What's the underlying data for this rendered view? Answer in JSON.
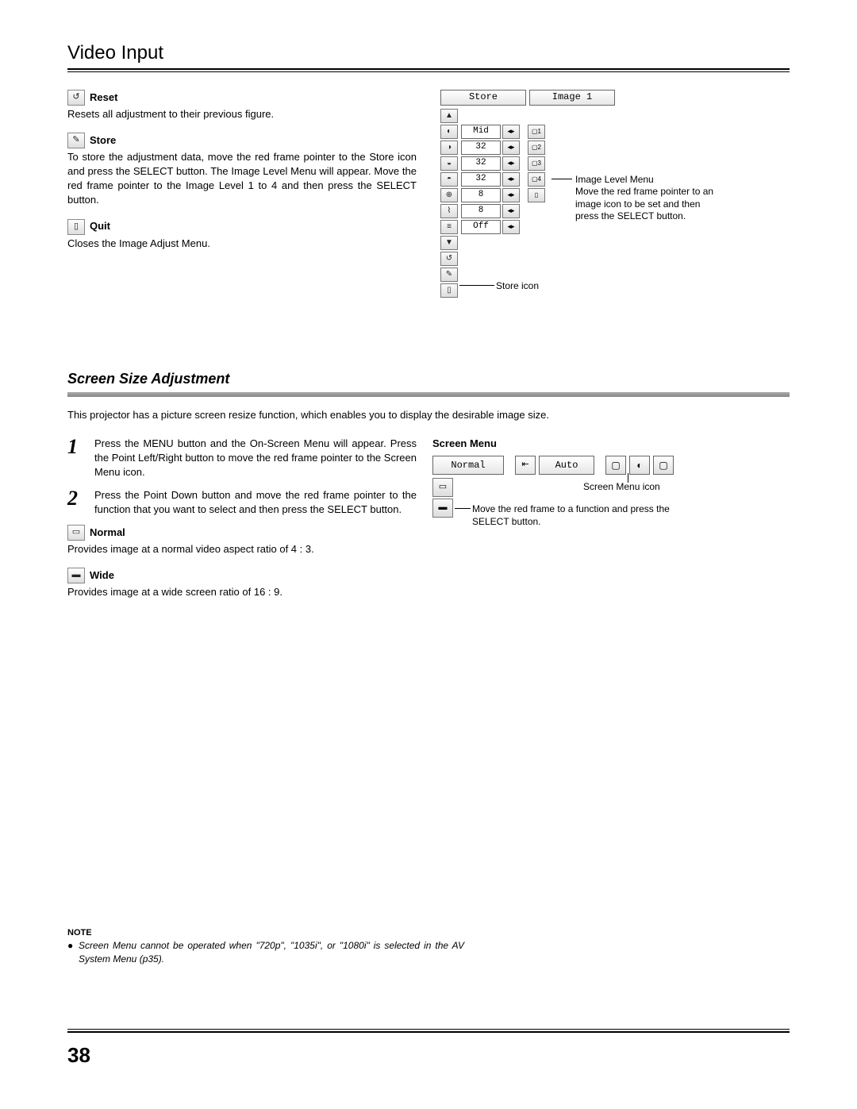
{
  "page": {
    "title": "Video Input",
    "number": "38"
  },
  "items": {
    "reset": {
      "label": "Reset",
      "desc": "Resets all adjustment to their previous figure."
    },
    "store": {
      "label": "Store",
      "desc": "To store the adjustment data, move the red frame pointer to the Store icon and press the SELECT button.  The Image Level Menu will appear.  Move the red frame pointer to the Image Level 1 to 4 and then press the SELECT button."
    },
    "quit": {
      "label": "Quit",
      "desc": "Closes the Image Adjust Menu."
    },
    "normal": {
      "label": "Normal",
      "desc": "Provides image at a normal video aspect ratio of 4 : 3."
    },
    "wide": {
      "label": "Wide",
      "desc": "Provides image at a wide screen ratio of 16 : 9."
    }
  },
  "osd": {
    "top_store": "Store",
    "top_image": "Image 1",
    "rows": [
      {
        "value": "Mid",
        "numLabel": "1"
      },
      {
        "value": "32",
        "numLabel": "2"
      },
      {
        "value": "32",
        "numLabel": "3"
      },
      {
        "value": "32",
        "numLabel": "4"
      },
      {
        "value": "8",
        "numLabel": ""
      },
      {
        "value": "8",
        "numLabel": ""
      },
      {
        "value": "Off",
        "numLabel": ""
      }
    ],
    "annot_title": "Image Level Menu",
    "annot_body": "Move the red frame pointer to an image icon to be set and then press the SELECT button.",
    "store_icon_label": "Store icon"
  },
  "section2": {
    "title": "Screen Size Adjustment",
    "intro": "This projector has a picture screen resize function, which enables you to display the desirable image size.",
    "step1": "Press the MENU button and the On-Screen Menu will appear. Press the Point Left/Right button to move the red frame pointer to the Screen Menu icon.",
    "step2": "Press the Point Down button and move the red frame pointer to the function that you want to select and then press the SELECT button.",
    "num1": "1",
    "num2": "2",
    "screen_menu_title": "Screen Menu",
    "normal_btn": "Normal",
    "auto_btn": "Auto",
    "annot_icon": "Screen Menu icon",
    "annot_body": "Move the red frame to a function and press the SELECT button."
  },
  "note": {
    "title": "NOTE",
    "text": "Screen Menu cannot be operated when \"720p\", \"1035i\", or \"1080i\" is selected in the AV System Menu (p35)."
  }
}
